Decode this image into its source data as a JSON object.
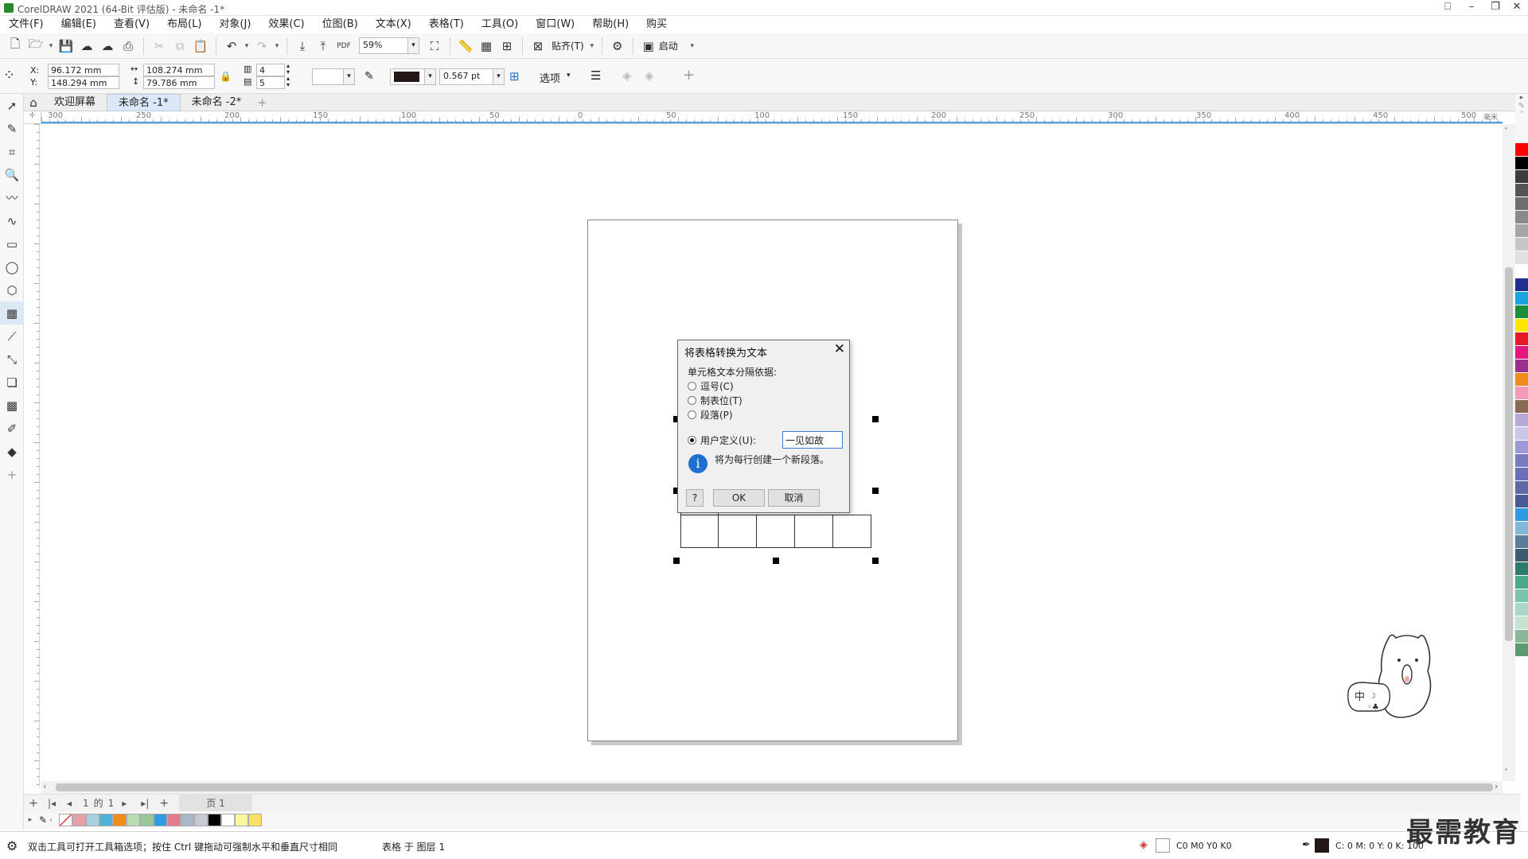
{
  "window": {
    "title": "CorelDRAW 2021 (64-Bit 评估版) - 未命名 -1*"
  },
  "menu": [
    "文件(F)",
    "编辑(E)",
    "查看(V)",
    "布局(L)",
    "对象(J)",
    "效果(C)",
    "位图(B)",
    "文本(X)",
    "表格(T)",
    "工具(O)",
    "窗口(W)",
    "帮助(H)",
    "购买"
  ],
  "toolbar": {
    "zoom": "59%",
    "snap_label": "贴齐(T)",
    "launch_label": "启动"
  },
  "props": {
    "x_label": "X:",
    "x": "96.172 mm",
    "y_label": "Y:",
    "y": "148.294 mm",
    "w": "108.274 mm",
    "h": "79.786 mm",
    "cols": "4",
    "rows": "5",
    "outline": "0.567 pt",
    "options": "选项"
  },
  "tabs": [
    "欢迎屏幕",
    "未命名 -1*",
    "未命名 -2*"
  ],
  "ruler": {
    "h_labels": [
      "300",
      "250",
      "200",
      "150",
      "100",
      "50",
      "0",
      "50",
      "100",
      "150",
      "200",
      "250",
      "300",
      "350",
      "400",
      "450",
      "500"
    ],
    "unit": "毫米"
  },
  "dialog": {
    "title": "将表格转换为文本",
    "group_label": "单元格文本分隔依据:",
    "options": [
      "逗号(C)",
      "制表位(T)",
      "段落(P)",
      "用户定义(U):"
    ],
    "selected_index": 3,
    "custom_value": "一见如故",
    "info_icon": "i",
    "info": "将为每行创建一个新段落。",
    "help": "?",
    "ok": "OK",
    "cancel": "取消"
  },
  "pagenav": {
    "first": "|◂",
    "prev": "◂",
    "current": "1",
    "of": "的",
    "total": "1",
    "next": "▸",
    "last": "▸|",
    "page_tab": "页 1"
  },
  "palette_bottom": [
    "#e8a0a8",
    "#a8d0e0",
    "#4fb3d9",
    "#f08c1a",
    "#b7dcb0",
    "#9ac79a",
    "#2f9be0",
    "#e27b8b",
    "#a8b8c8",
    "#c9c9d6",
    "#000000",
    "#ffffff",
    "#fdf6a0",
    "#f9e067"
  ],
  "palette_right": [
    "#ff0000",
    "#000000",
    "#3c3c3c",
    "#555555",
    "#6e6e6e",
    "#8a8a8a",
    "#a6a6a6",
    "#c6c6c6",
    "#e0e0e0",
    "#ffffff",
    "#1f2f8f",
    "#17a4e0",
    "#1a8f3a",
    "#ffe600",
    "#e8182b",
    "#e5177e",
    "#9b2f8c",
    "#f08c1a",
    "#f29ab6",
    "#8a6a52",
    "#b7a8d6",
    "#c8c8e8",
    "#9a9ad6",
    "#7a7ac0",
    "#6a70b8",
    "#5e6aa8",
    "#4a5a94",
    "#2f9be0",
    "#84b8d8",
    "#5a7e9a",
    "#3e5a6e",
    "#2e7a6a",
    "#4aa88c",
    "#7ac4a8",
    "#a8d8c4",
    "#c4e4d4",
    "#8ab89a",
    "#5a9a6e"
  ],
  "status": {
    "hint": "双击工具可打开工具箱选项；按住 Ctrl 键拖动可强制水平和垂直尺寸相同",
    "layer": "表格 于 图层 1",
    "fill": "C0 M0 Y0 K0",
    "outline_vals": "C: 0 M: 0 Y: 0 K: 100"
  },
  "watermark": "最需教育"
}
